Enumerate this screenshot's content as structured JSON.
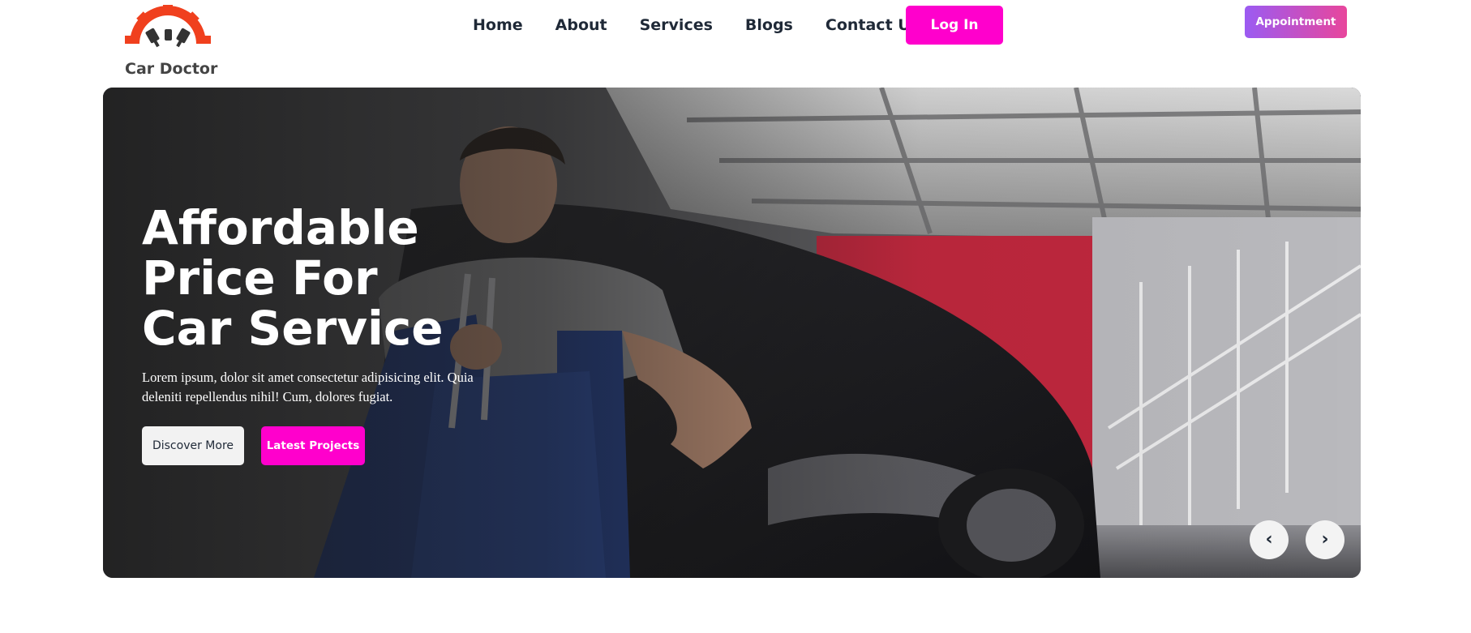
{
  "brand": {
    "name": "Car Doctor"
  },
  "nav": {
    "items": [
      {
        "label": "Home"
      },
      {
        "label": "About"
      },
      {
        "label": "Services"
      },
      {
        "label": "Blogs"
      },
      {
        "label": "Contact Us"
      }
    ],
    "login_label": "Log In",
    "appointment_label": "Appointment"
  },
  "hero": {
    "title": "Affordable Price For Car Service",
    "description": "Lorem ipsum, dolor sit amet consectetur adipisicing elit. Quia deleniti repellendus nihil! Cum, dolores fugiat.",
    "primary_button": "Discover More",
    "secondary_button": "Latest Projects",
    "prev_glyph": "‹",
    "next_glyph": "›"
  },
  "colors": {
    "accent": "#ff00cc",
    "logo_orange": "#f0401e",
    "gradient_start": "#9b5bf2",
    "gradient_end": "#e8469c"
  },
  "icons": {
    "logo": "gear-with-pistons-icon",
    "prev": "chevron-left-icon",
    "next": "chevron-right-icon"
  }
}
